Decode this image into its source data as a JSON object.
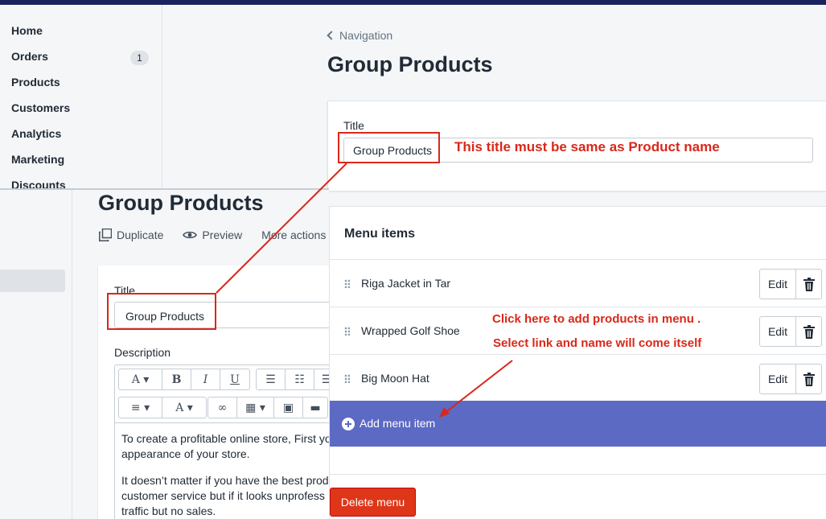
{
  "sidebar": {
    "items": [
      {
        "label": "Home"
      },
      {
        "label": "Orders",
        "badge": "1"
      },
      {
        "label": "Products"
      },
      {
        "label": "Customers"
      },
      {
        "label": "Analytics"
      },
      {
        "label": "Marketing"
      },
      {
        "label": "Discounts"
      }
    ]
  },
  "header": {
    "breadcrumb": "Navigation",
    "title": "Group Products"
  },
  "title_card": {
    "label": "Title",
    "value": "Group Products"
  },
  "menu": {
    "heading": "Menu items",
    "items": [
      {
        "name": "Riga Jacket in Tar",
        "edit_label": "Edit"
      },
      {
        "name": "Wrapped Golf Shoe",
        "edit_label": "Edit"
      },
      {
        "name": "Big Moon Hat",
        "edit_label": "Edit"
      }
    ],
    "add_label": "Add menu item",
    "delete_label": "Delete menu"
  },
  "product_page": {
    "title": "Group Products",
    "actions": [
      "Duplicate",
      "Preview",
      "More actions"
    ],
    "title_label": "Title",
    "title_value": "Group Products",
    "description_label": "Description",
    "description": [
      "To create a profitable online store, First yo",
      "appearance of your store.",
      "It doesn’t matter if you have the best prod",
      "customer service but if it looks unprofess",
      "traffic but no sales."
    ]
  },
  "annotations": {
    "title_note": "This title must be same as Product name",
    "add_note_1": "Click here to add products in menu .",
    "add_note_2": "Select link and name will come itself"
  },
  "colors": {
    "accent": "#5c6ac4",
    "danger": "#de3618",
    "annotation": "#d9281a",
    "topbar": "#1c2260"
  }
}
